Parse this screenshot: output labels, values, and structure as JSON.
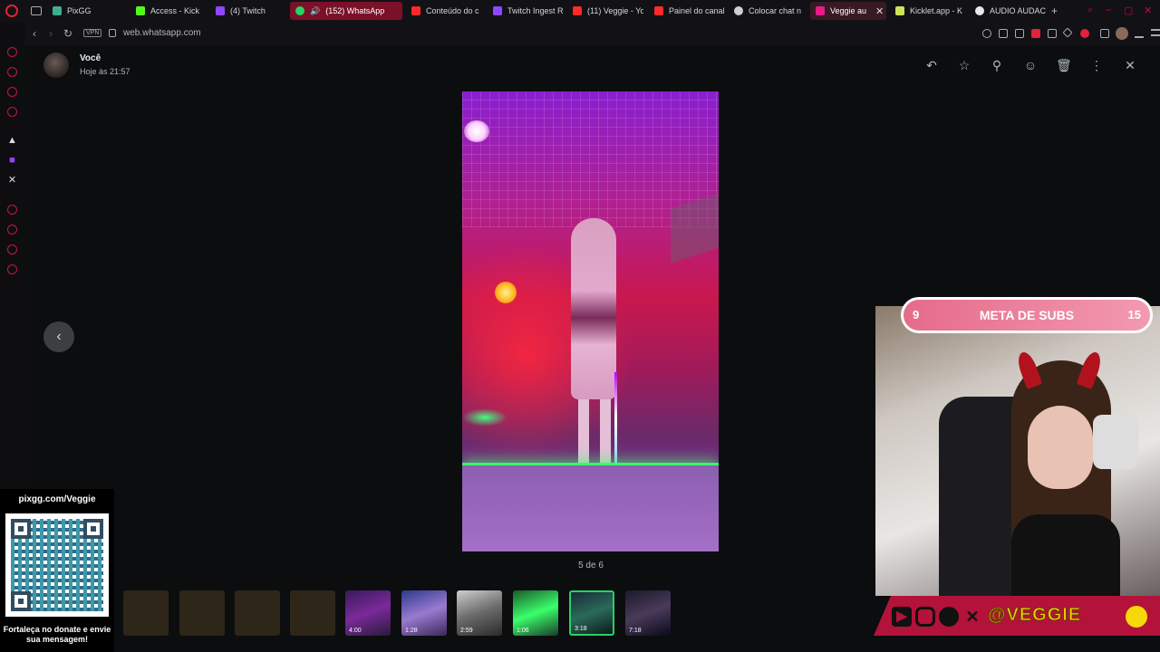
{
  "browser": {
    "tabs": [
      {
        "label": "PixGG",
        "color": "#3fae8f"
      },
      {
        "label": "Access - Kick",
        "color": "#53fc18"
      },
      {
        "label": "(4) Twitch",
        "color": "#9146ff"
      },
      {
        "label": "(152) WhatsApp",
        "color": "#25d366"
      },
      {
        "label": "Conteúdo do c",
        "color": "#ff2a2a"
      },
      {
        "label": "Twitch Ingest R",
        "color": "#9146ff"
      },
      {
        "label": "(11) Veggie - Yo",
        "color": "#ff2a2a"
      },
      {
        "label": "Painel do canal",
        "color": "#ff2a2a"
      },
      {
        "label": "Colocar chat n",
        "color": "#cfcfcf"
      },
      {
        "label": "Veggie au",
        "color": "#e61c8a"
      },
      {
        "label": "Kicklet.app - K",
        "color": "#cde35a"
      },
      {
        "label": "AUDIO AUDACI",
        "color": "#e8e8e8"
      }
    ],
    "active_tab_close": "✕",
    "new_tab": "+",
    "vpn_label": "VPN",
    "url": "web.whatsapp.com"
  },
  "viewer": {
    "sender_name": "Você",
    "sender_time": "Hoje às 21:57",
    "counter": "5 de 6",
    "toolbar": {
      "reply_icon": "reply-icon",
      "star_icon": "star-icon",
      "pin_icon": "pin-icon",
      "emoji_icon": "emoji-icon",
      "delete_icon": "delete-icon",
      "menu_icon": "more-vertical-icon",
      "close_icon": "close-icon"
    },
    "thumbnails": [
      {
        "duration": ""
      },
      {
        "duration": ""
      },
      {
        "duration": ""
      },
      {
        "duration": ""
      },
      {
        "duration": "4:00"
      },
      {
        "duration": "1:28"
      },
      {
        "duration": "2:59"
      },
      {
        "duration": "1:06"
      },
      {
        "duration": "3:18"
      },
      {
        "duration": "7:18"
      }
    ]
  },
  "overlay": {
    "pix_url": "pixgg.com/Veggie",
    "pix_message": "Fortaleça no donate e envie sua mensagem!",
    "goal": {
      "min": "9",
      "label": "META DE SUBS",
      "max": "15"
    },
    "handle": "@VEGGIE"
  }
}
